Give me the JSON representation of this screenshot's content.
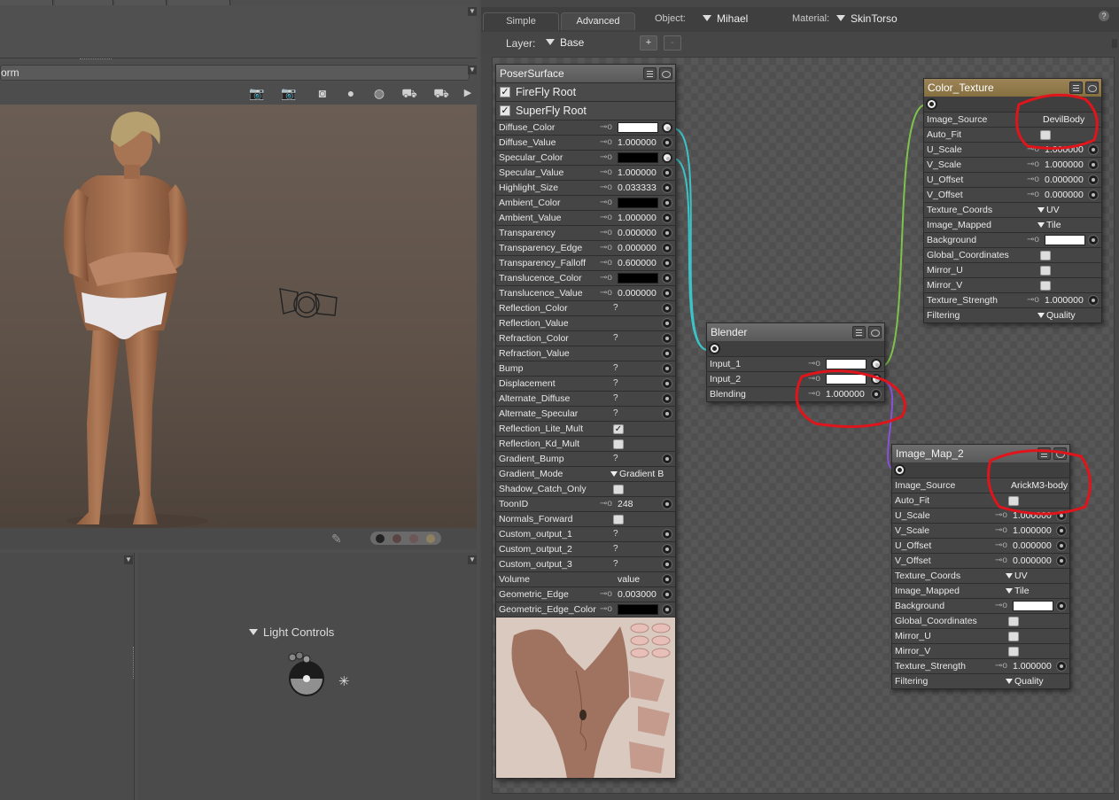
{
  "left_panel": {
    "viewport_title": "orm",
    "light_controls_label": "Light Controls"
  },
  "right_panel": {
    "tabs": [
      "Simple",
      "Advanced"
    ],
    "object_label": "Object:",
    "object_value": "Mihael",
    "material_label": "Material:",
    "material_value": "SkinTorso",
    "help": "?",
    "layer_label": "Layer:",
    "layer_value": "Base",
    "add_layer": "+",
    "remove_layer": "-"
  },
  "poser_surface": {
    "title": "PoserSurface",
    "roots": [
      {
        "label": "FireFly Root",
        "checked": true
      },
      {
        "label": "SuperFly Root",
        "checked": true
      }
    ],
    "rows": [
      {
        "label": "Diffuse_Color",
        "kind": "color",
        "color": "#ffffff",
        "out": "link"
      },
      {
        "label": "Diffuse_Value",
        "kind": "num",
        "value": "1.000000"
      },
      {
        "label": "Specular_Color",
        "kind": "color",
        "color": "#000000",
        "out": "link"
      },
      {
        "label": "Specular_Value",
        "kind": "num",
        "value": "1.000000"
      },
      {
        "label": "Highlight_Size",
        "kind": "num",
        "value": "0.033333"
      },
      {
        "label": "Ambient_Color",
        "kind": "color",
        "color": "#000000"
      },
      {
        "label": "Ambient_Value",
        "kind": "num",
        "value": "1.000000"
      },
      {
        "label": "Transparency",
        "kind": "num",
        "value": "0.000000"
      },
      {
        "label": "Transparency_Edge",
        "kind": "num",
        "value": "0.000000"
      },
      {
        "label": "Transparency_Falloff",
        "kind": "num",
        "value": "0.600000"
      },
      {
        "label": "Translucence_Color",
        "kind": "color",
        "color": "#000000"
      },
      {
        "label": "Translucence_Value",
        "kind": "num",
        "value": "0.000000"
      },
      {
        "label": "Reflection_Color",
        "kind": "q",
        "value": "?"
      },
      {
        "label": "Reflection_Value",
        "kind": "empty"
      },
      {
        "label": "Refraction_Color",
        "kind": "q",
        "value": "?"
      },
      {
        "label": "Refraction_Value",
        "kind": "empty"
      },
      {
        "label": "Bump",
        "kind": "q",
        "value": "?"
      },
      {
        "label": "Displacement",
        "kind": "q",
        "value": "?"
      },
      {
        "label": "Alternate_Diffuse",
        "kind": "q",
        "value": "?"
      },
      {
        "label": "Alternate_Specular",
        "kind": "q",
        "value": "?"
      },
      {
        "label": "Reflection_Lite_Mult",
        "kind": "check",
        "checked": true
      },
      {
        "label": "Reflection_Kd_Mult",
        "kind": "check",
        "checked": false
      },
      {
        "label": "Gradient_Bump",
        "kind": "q",
        "value": "?"
      },
      {
        "label": "Gradient_Mode",
        "kind": "dd",
        "value": "Gradient B"
      },
      {
        "label": "Shadow_Catch_Only",
        "kind": "check",
        "checked": false
      },
      {
        "label": "ToonID",
        "kind": "num",
        "value": "248"
      },
      {
        "label": "Normals_Forward",
        "kind": "check",
        "checked": false
      },
      {
        "label": "Custom_output_1",
        "kind": "q",
        "value": "?"
      },
      {
        "label": "Custom_output_2",
        "kind": "q",
        "value": "?"
      },
      {
        "label": "Custom_output_3",
        "kind": "q",
        "value": "?"
      },
      {
        "label": "Volume",
        "kind": "text",
        "value": "value"
      },
      {
        "label": "Geometric_Edge",
        "kind": "num",
        "value": "0.003000"
      },
      {
        "label": "Geometric_Edge_Color",
        "kind": "color",
        "color": "#000000"
      }
    ]
  },
  "blender": {
    "title": "Blender",
    "rows": [
      {
        "label": "Input_1",
        "kind": "color",
        "color": "#ffffff",
        "out": "link"
      },
      {
        "label": "Input_2",
        "kind": "color",
        "color": "#ffffff",
        "out": "link"
      },
      {
        "label": "Blending",
        "kind": "num",
        "value": "1.000000"
      }
    ]
  },
  "color_texture": {
    "title": "Color_Texture",
    "rows": [
      {
        "label": "Image_Source",
        "kind": "text",
        "value": "DevilBody"
      },
      {
        "label": "Auto_Fit",
        "kind": "check",
        "checked": false
      },
      {
        "label": "U_Scale",
        "kind": "num",
        "value": "1.000000"
      },
      {
        "label": "V_Scale",
        "kind": "num",
        "value": "1.000000"
      },
      {
        "label": "U_Offset",
        "kind": "num",
        "value": "0.000000"
      },
      {
        "label": "V_Offset",
        "kind": "num",
        "value": "0.000000"
      },
      {
        "label": "Texture_Coords",
        "kind": "dd",
        "value": "UV"
      },
      {
        "label": "Image_Mapped",
        "kind": "dd",
        "value": "Tile"
      },
      {
        "label": "Background",
        "kind": "color",
        "color": "#ffffff"
      },
      {
        "label": "Global_Coordinates",
        "kind": "check",
        "checked": false
      },
      {
        "label": "Mirror_U",
        "kind": "check",
        "checked": false
      },
      {
        "label": "Mirror_V",
        "kind": "check",
        "checked": false
      },
      {
        "label": "Texture_Strength",
        "kind": "num",
        "value": "1.000000"
      },
      {
        "label": "Filtering",
        "kind": "dd",
        "value": "Quality"
      }
    ]
  },
  "image_map_2": {
    "title": "Image_Map_2",
    "rows": [
      {
        "label": "Image_Source",
        "kind": "text",
        "value": "ArickM3-body"
      },
      {
        "label": "Auto_Fit",
        "kind": "check",
        "checked": false
      },
      {
        "label": "U_Scale",
        "kind": "num",
        "value": "1.000000"
      },
      {
        "label": "V_Scale",
        "kind": "num",
        "value": "1.000000"
      },
      {
        "label": "U_Offset",
        "kind": "num",
        "value": "0.000000"
      },
      {
        "label": "V_Offset",
        "kind": "num",
        "value": "0.000000"
      },
      {
        "label": "Texture_Coords",
        "kind": "dd",
        "value": "UV"
      },
      {
        "label": "Image_Mapped",
        "kind": "dd",
        "value": "Tile"
      },
      {
        "label": "Background",
        "kind": "color",
        "color": "#ffffff"
      },
      {
        "label": "Global_Coordinates",
        "kind": "check",
        "checked": false
      },
      {
        "label": "Mirror_U",
        "kind": "check",
        "checked": false
      },
      {
        "label": "Mirror_V",
        "kind": "check",
        "checked": false
      },
      {
        "label": "Texture_Strength",
        "kind": "num",
        "value": "1.000000"
      },
      {
        "label": "Filtering",
        "kind": "dd",
        "value": "Quality"
      }
    ]
  },
  "colors": {
    "wire_cyan": "#3cc3c8",
    "wire_green": "#7fc24a",
    "wire_purple": "#8a52d6",
    "annotation_red": "#e0141b",
    "texture_header": "#8f7848"
  }
}
